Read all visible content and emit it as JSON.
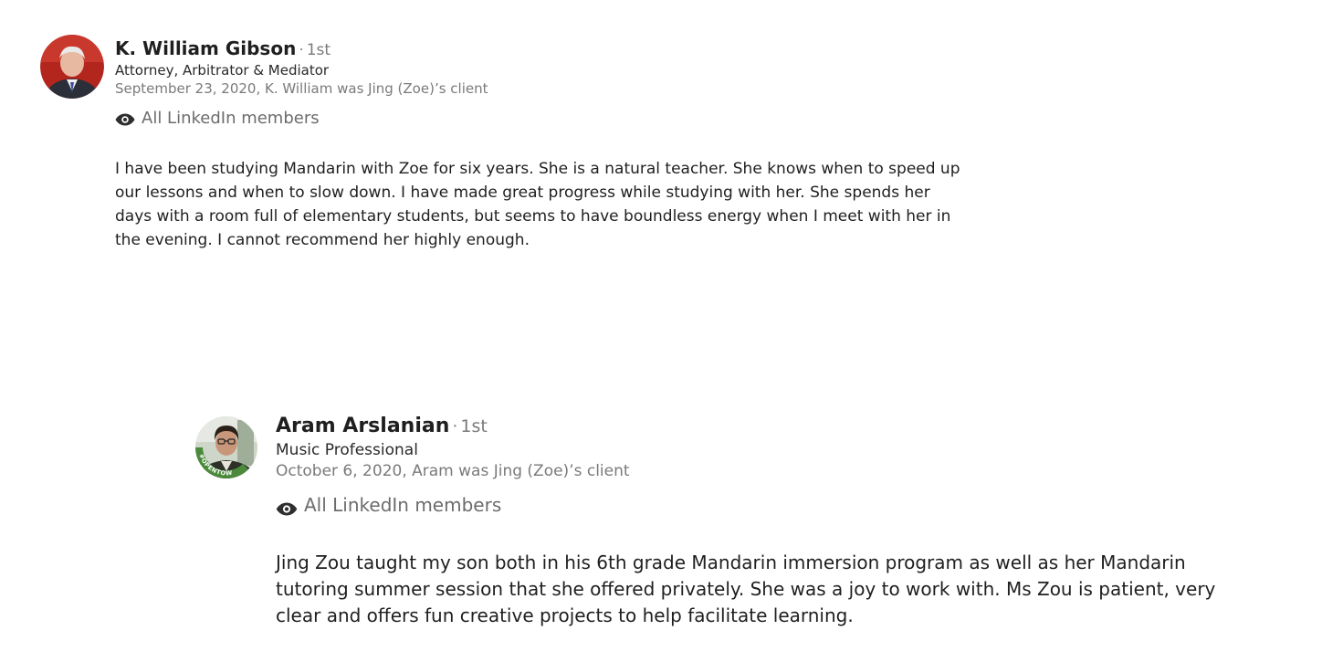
{
  "recommendations": [
    {
      "name": "K. William Gibson",
      "separator": "·",
      "degree": "1st",
      "headline": "Attorney, Arbitrator & Mediator",
      "meta": "September 23, 2020, K. William was Jing (Zoe)’s client",
      "visibility": "All LinkedIn members",
      "visibility_icon": "eye-icon",
      "text": "I have been studying Mandarin with Zoe for six years.  She is a natural teacher.  She knows when to speed up our lessons and when to slow down.  I have made great progress while studying with her.  She spends her days with a room full of elementary students, but seems to have boundless energy when I meet with her in the evening.  I cannot recommend her highly enough."
    },
    {
      "name": "Aram Arslanian",
      "separator": "·",
      "degree": "1st",
      "headline": "Music Professional",
      "meta": "October 6, 2020, Aram was Jing (Zoe)’s client",
      "visibility": "All LinkedIn members",
      "visibility_icon": "eye-icon",
      "avatar_frame_label": "#OPENTOWORK",
      "text": "Jing Zou taught my son both in his 6th grade Mandarin immersion program as well as her Mandarin tutoring summer session that she offered privately. She was a joy to work with. Ms Zou is patient, very clear and offers fun creative projects to help facilitate learning."
    }
  ],
  "colors": {
    "open_to_work_green": "#4a8a3a",
    "text_primary": "#1f1f1f",
    "text_secondary": "#7a7a7a"
  }
}
